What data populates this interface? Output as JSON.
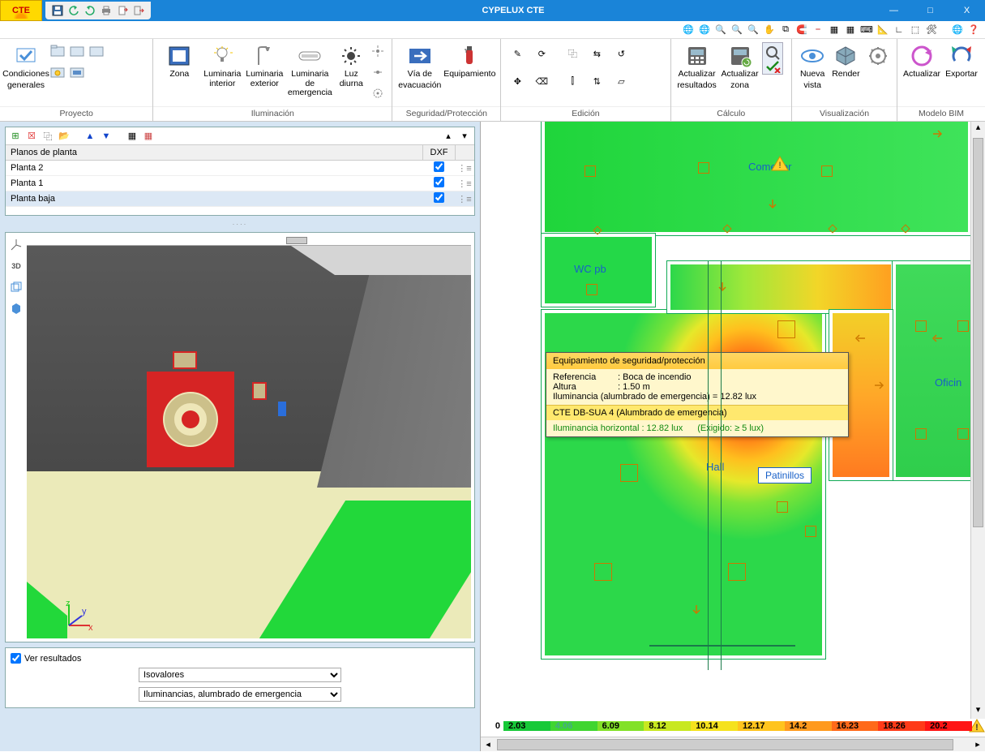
{
  "app": {
    "title": "CYPELUX CTE",
    "logo_text": "CTE"
  },
  "win": {
    "min": "—",
    "max": "□",
    "close": "X"
  },
  "ribbon": {
    "group1": {
      "title": "Proyecto",
      "cond_l1": "Condiciones",
      "cond_l2": "generales"
    },
    "group2": {
      "title": "Iluminación",
      "zona": "Zona",
      "li": "Luminaria interior",
      "le": "Luminaria exterior",
      "lem": "Luminaria de emergencia",
      "ld": "Luz diurna"
    },
    "group3": {
      "title": "Seguridad/Protección",
      "via1": "Vía de",
      "via2": "evacuación",
      "equip": "Equipamiento"
    },
    "group4": {
      "title": "Edición"
    },
    "group5": {
      "title": "Cálculo",
      "ar1": "Actualizar",
      "ar2": "resultados",
      "az1": "Actualizar",
      "az2": "zona"
    },
    "group6": {
      "title": "Visualización",
      "nv1": "Nueva",
      "nv2": "vista",
      "render": "Render"
    },
    "group7": {
      "title": "Modelo BIM",
      "act": "Actualizar",
      "exp": "Exportar"
    }
  },
  "plans": {
    "header": "Planos de planta",
    "dxf": "DXF",
    "rows": [
      {
        "name": "Planta 2",
        "dxf": true
      },
      {
        "name": "Planta 1",
        "dxf": true
      },
      {
        "name": "Planta baja",
        "dxf": true
      }
    ]
  },
  "results": {
    "show": "Ver resultados",
    "select1": "Isovalores",
    "select2": "Iluminancias, alumbrado de emergencia"
  },
  "roomlabels": {
    "comedor": "Comedor",
    "wc": "WC pb",
    "hall": "Hall",
    "oficina": "Oficin",
    "patinillos": "Patinillos"
  },
  "tooltip": {
    "title": "Equipamiento de seguridad/protección",
    "ref_k": "Referencia",
    "ref_v": ": Boca de incendio",
    "alt_k": "Altura",
    "alt_v": ": 1.50 m",
    "ilum": "Iluminancia (alumbrado de emergencia) = 12.82 lux",
    "sec": "CTE DB-SUA 4 (Alumbrado de emergencia)",
    "fh": "Iluminancia horizontal : 12.82 lux",
    "fe": "(Exigido: ≥ 5 lux)"
  },
  "legend": {
    "zero": "0",
    "vals": [
      "2.03",
      "4.06",
      "6.09",
      "8.12",
      "10.14",
      "12.17",
      "14.2",
      "16.23",
      "18.26",
      "20.2"
    ]
  }
}
